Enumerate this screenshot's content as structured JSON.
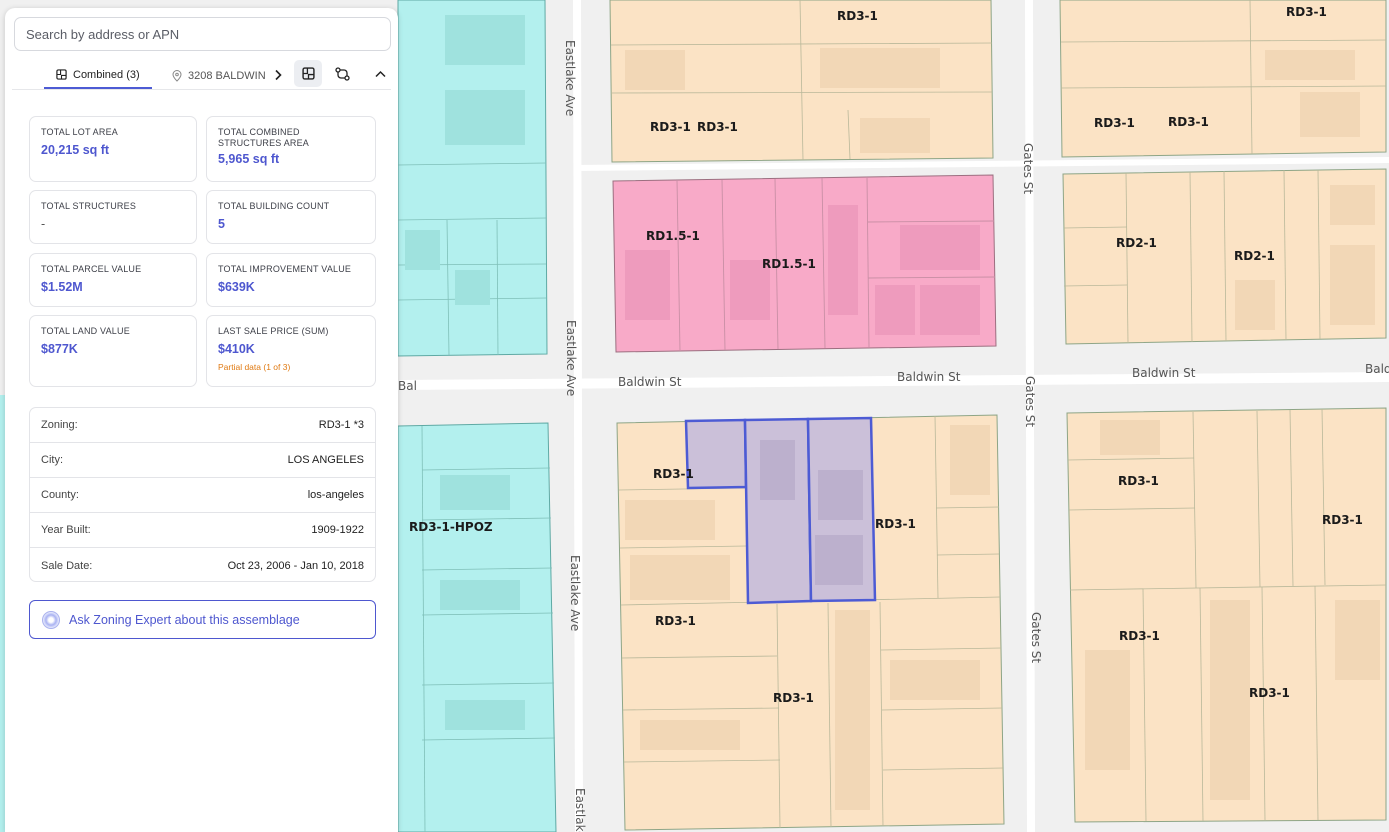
{
  "app": {
    "search_placeholder": "Search by address or APN"
  },
  "tabs": {
    "combined_label": "Combined (3)",
    "address_label": "3208 BALDWIN"
  },
  "stats": [
    {
      "label": "TOTAL LOT AREA",
      "value": "20,215 sq ft"
    },
    {
      "label": "TOTAL COMBINED STRUCTURES AREA",
      "value": "5,965 sq ft"
    },
    {
      "label": "TOTAL STRUCTURES",
      "value": "-"
    },
    {
      "label": "TOTAL BUILDING COUNT",
      "value": "5"
    },
    {
      "label": "TOTAL PARCEL VALUE",
      "value": "$1.52M"
    },
    {
      "label": "TOTAL IMPROVEMENT VALUE",
      "value": "$639K"
    },
    {
      "label": "TOTAL LAND VALUE",
      "value": "$877K"
    },
    {
      "label": "LAST SALE PRICE (SUM)",
      "value": "$410K",
      "note": "Partial data (1 of 3)"
    }
  ],
  "details": [
    {
      "label": "Zoning:",
      "value": "RD3-1 *3"
    },
    {
      "label": "City:",
      "value": "LOS ANGELES"
    },
    {
      "label": "County:",
      "value": "los-angeles"
    },
    {
      "label": "Year Built:",
      "value": "1909-1922"
    },
    {
      "label": "Sale Date:",
      "value": "Oct 23, 2006 - Jan 10, 2018"
    }
  ],
  "ask_label": "Ask Zoning Expert about this assemblage",
  "map": {
    "colors": {
      "rd3": "#fbe3c5",
      "rd15": "#f8aac8",
      "hpoz": "#b3f0ee",
      "selected_fill": "#cbc0d9",
      "selected_stroke": "#4d5bd4",
      "street": "#ffffff",
      "parcel_line": "#8ea586"
    },
    "zone_labels": [
      "RD3-1",
      "RD3-1",
      "RD3-1",
      "RD3-1",
      "RD3-1",
      "RD3-1",
      "RD1.5-1",
      "RD1.5-1",
      "RD2-1",
      "RD2-1",
      "RD3-1",
      "RD3-1",
      "RD3-1-HPOZ",
      "RD3-1",
      "RD3-1",
      "RD3-1",
      "RD3-1",
      "RD3-1",
      "RD3-1",
      "RD3-1",
      "RD3-1"
    ],
    "street_labels": [
      "Eastlake Ave",
      "Eastlake Ave",
      "Eastlake Ave",
      "Eastlake",
      "Gates St",
      "Gates St",
      "Gates St",
      "Baldwin St",
      "Baldwin St",
      "Baldwin St",
      "Baldwin St",
      "Bal",
      "ldwin St"
    ]
  }
}
